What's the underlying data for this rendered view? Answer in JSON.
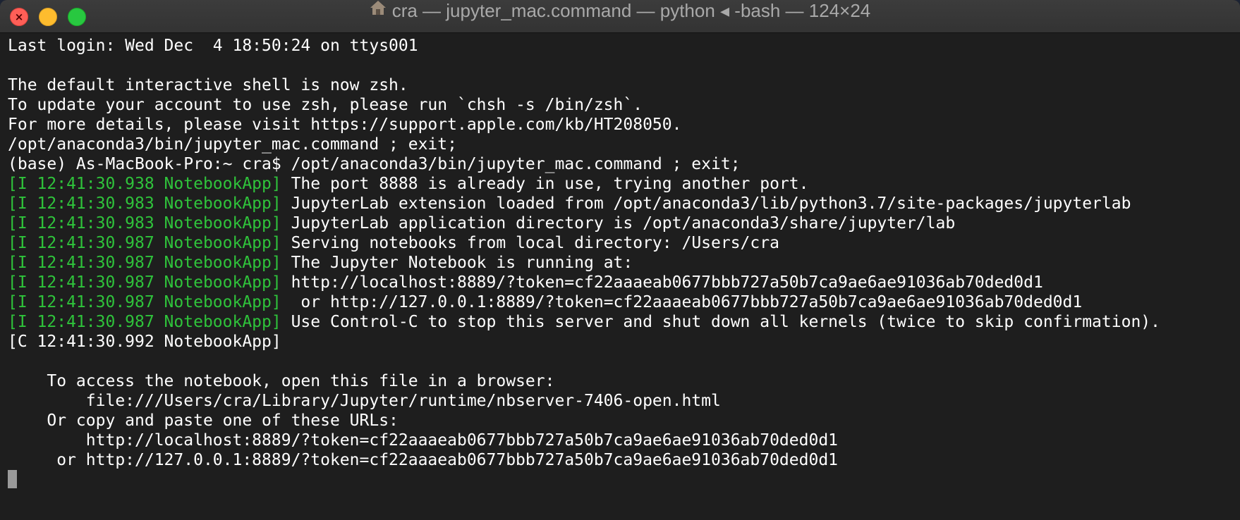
{
  "window": {
    "title": "cra — jupyter_mac.command — python ◂ -bash — 124×24",
    "home_icon": "home-folder-icon"
  },
  "colors": {
    "background": "#1e1e1e",
    "text": "#ffffff",
    "tag": "#2fc33b",
    "titlebar": "#383838",
    "close": "#fe5f57",
    "minimize": "#febc2e",
    "zoom": "#28c840"
  },
  "terminal": {
    "lines": [
      {
        "text": "Last login: Wed Dec  4 18:50:24 on ttys001"
      },
      {
        "text": ""
      },
      {
        "text": "The default interactive shell is now zsh."
      },
      {
        "text": "To update your account to use zsh, please run `chsh -s /bin/zsh`."
      },
      {
        "text": "For more details, please visit https://support.apple.com/kb/HT208050."
      },
      {
        "text": "/opt/anaconda3/bin/jupyter_mac.command ; exit;"
      },
      {
        "text": "(base) As-MacBook-Pro:~ cra$ /opt/anaconda3/bin/jupyter_mac.command ; exit;"
      },
      {
        "tag": "[I 12:41:30.938 NotebookApp]",
        "text": " The port 8888 is already in use, trying another port."
      },
      {
        "tag": "[I 12:41:30.983 NotebookApp]",
        "text": " JupyterLab extension loaded from /opt/anaconda3/lib/python3.7/site-packages/jupyterlab"
      },
      {
        "tag": "[I 12:41:30.983 NotebookApp]",
        "text": " JupyterLab application directory is /opt/anaconda3/share/jupyter/lab"
      },
      {
        "tag": "[I 12:41:30.987 NotebookApp]",
        "text": " Serving notebooks from local directory: /Users/cra"
      },
      {
        "tag": "[I 12:41:30.987 NotebookApp]",
        "text": " The Jupyter Notebook is running at:"
      },
      {
        "tag": "[I 12:41:30.987 NotebookApp]",
        "text": " http://localhost:8889/?token=cf22aaaeab0677bbb727a50b7ca9ae6ae91036ab70ded0d1"
      },
      {
        "tag": "[I 12:41:30.987 NotebookApp]",
        "text": "  or http://127.0.0.1:8889/?token=cf22aaaeab0677bbb727a50b7ca9ae6ae91036ab70ded0d1"
      },
      {
        "tag": "[I 12:41:30.987 NotebookApp]",
        "text": " Use Control-C to stop this server and shut down all kernels (twice to skip confirmation)."
      },
      {
        "text": "[C 12:41:30.992 NotebookApp]"
      },
      {
        "text": ""
      },
      {
        "text": "    To access the notebook, open this file in a browser:"
      },
      {
        "text": "        file:///Users/cra/Library/Jupyter/runtime/nbserver-7406-open.html"
      },
      {
        "text": "    Or copy and paste one of these URLs:"
      },
      {
        "text": "        http://localhost:8889/?token=cf22aaaeab0677bbb727a50b7ca9ae6ae91036ab70ded0d1"
      },
      {
        "text": "     or http://127.0.0.1:8889/?token=cf22aaaeab0677bbb727a50b7ca9ae6ae91036ab70ded0d1"
      }
    ]
  }
}
